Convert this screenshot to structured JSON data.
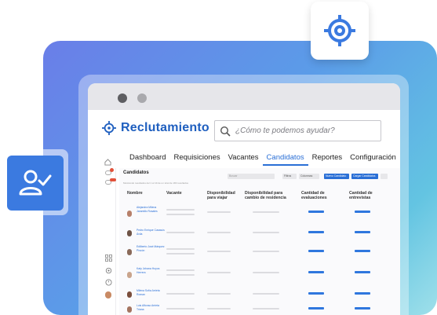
{
  "colors": {
    "accent": "#2a6fd6",
    "badge": "#3b7ae0",
    "panel_from": "#6a7ee8",
    "panel_to": "#9fe0ea"
  },
  "icons": {
    "target": "target-icon",
    "user_check": "user-check-icon",
    "search": "search-icon"
  },
  "app": {
    "title": "Reclutamiento"
  },
  "search": {
    "placeholder": "¿Cómo te podemos ayudar?"
  },
  "nav": {
    "items": [
      "Dashboard",
      "Requisiciones",
      "Vacantes",
      "Candidatos",
      "Reportes",
      "Configuración"
    ],
    "active": "Candidatos"
  },
  "toolbar": {
    "title": "Candidatos",
    "subtitle": "Mostrando resultados del 1 al 10 de un total de 180 resultados",
    "search_placeholder": "Buscar",
    "buttons": [
      "Filtros",
      "Columnas",
      "Nuevo Candidato",
      "Cargar Candidatos"
    ]
  },
  "table": {
    "headers": [
      "Nombre",
      "Vacante",
      "Disponibilidad para viajar",
      "Disponibilidad para cambio de residencia",
      "Cantidad de evaluaciones",
      "Cantidad de entrevistas"
    ],
    "rows": [
      {
        "name": "Alejandra Milena Jaramillo Rosales"
      },
      {
        "name": "Pedro Enrique Casasús Ávila"
      },
      {
        "name": "Edilberto José Márquez Pinzón"
      },
      {
        "name": "Katy Johana Hoyos Herrera"
      },
      {
        "name": "Milena Sofía Arrieta Roman"
      },
      {
        "name": "Luis Alfonso Arrieta Triana"
      }
    ]
  }
}
